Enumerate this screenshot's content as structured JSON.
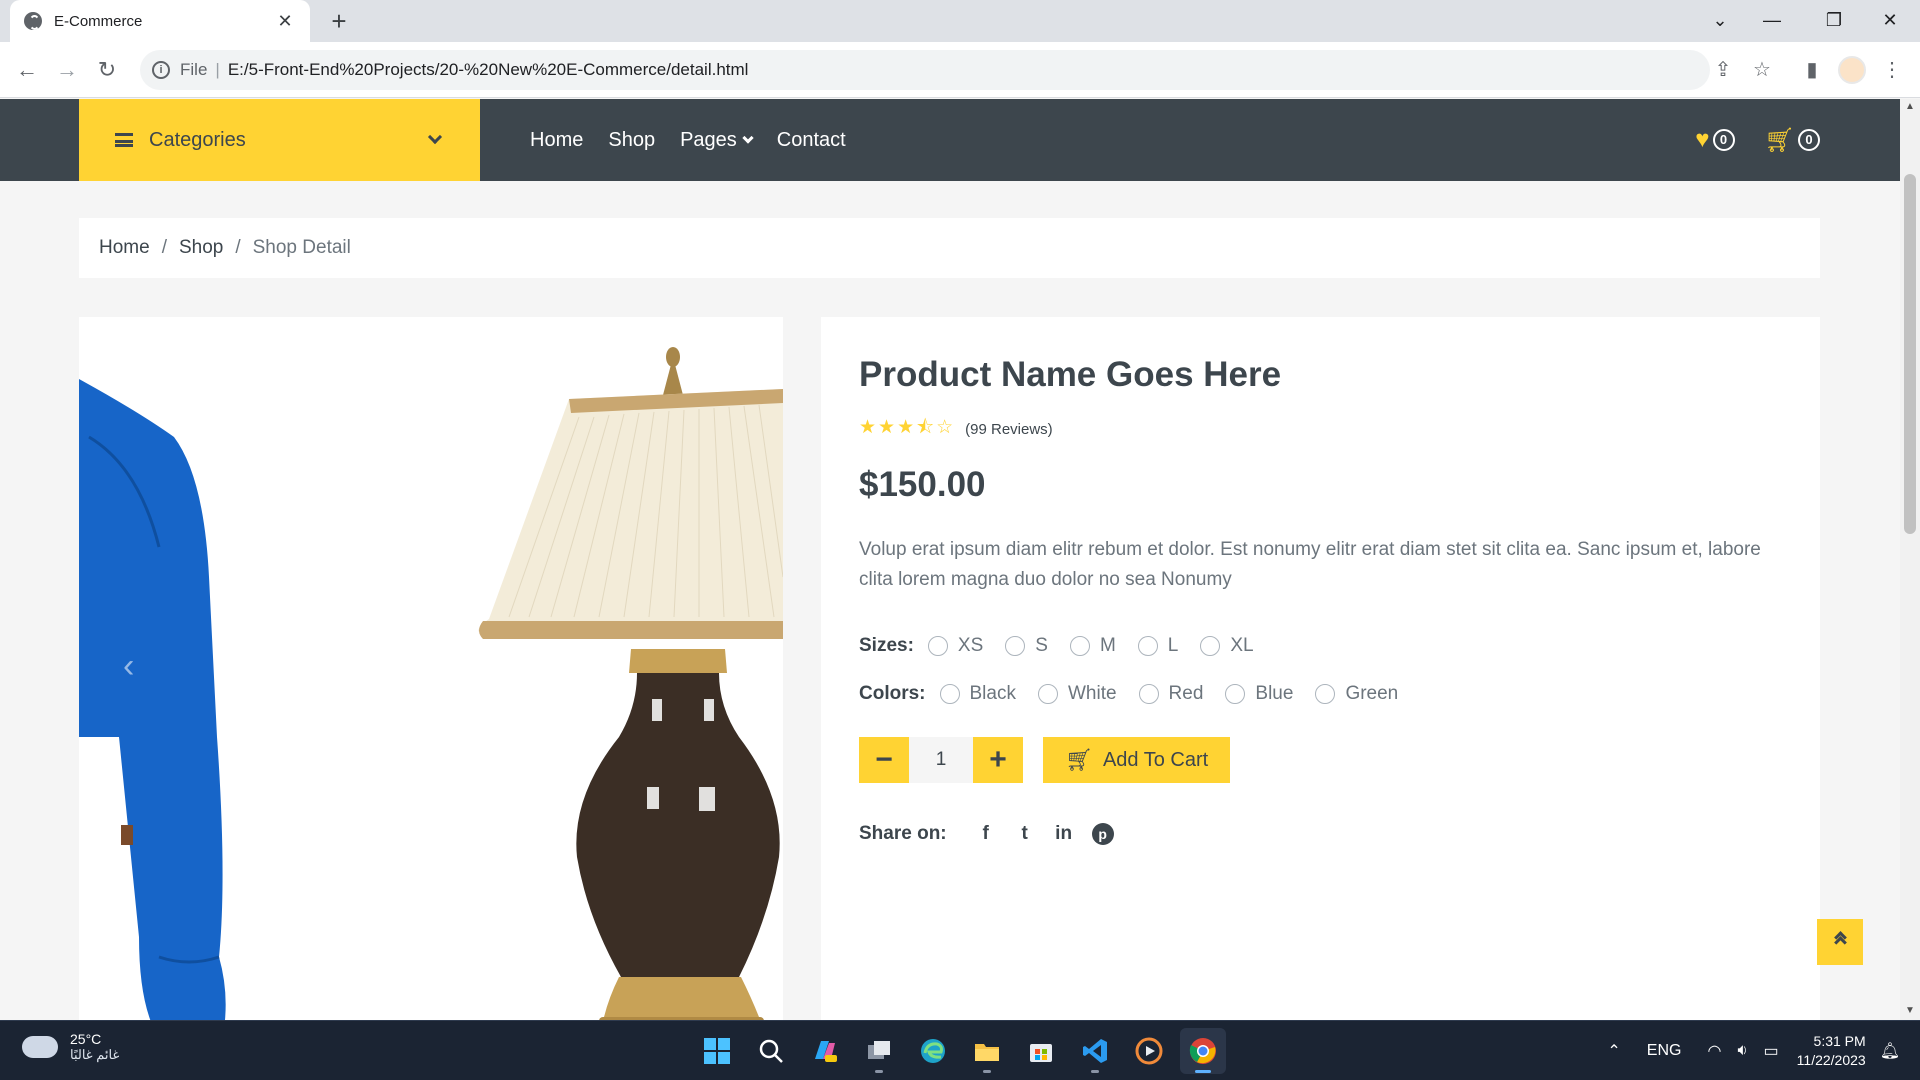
{
  "browser": {
    "tab_title": "E-Commerce",
    "tab_close": "✕",
    "new_tab": "+",
    "scheme": "File",
    "url": "E:/5-Front-End%20Projects/20-%20New%20E-Commerce/detail.html"
  },
  "nav": {
    "categories_label": "Categories",
    "links": [
      "Home",
      "Shop",
      "Pages",
      "Contact"
    ],
    "wishlist_count": "0",
    "cart_count": "0"
  },
  "breadcrumb": {
    "home": "Home",
    "shop": "Shop",
    "current": "Shop Detail",
    "separator": "/"
  },
  "product": {
    "name": "Product Name Goes Here",
    "rating": 3.5,
    "stars": "★★★⯪☆",
    "reviews": "(99 Reviews)",
    "price": "$150.00",
    "description": "Volup erat ipsum diam elitr rebum et dolor. Est nonumy elitr erat diam stet sit clita ea. Sanc ipsum et, labore clita lorem magna duo dolor no sea Nonumy",
    "sizes_label": "Sizes:",
    "sizes": [
      "XS",
      "S",
      "M",
      "L",
      "XL"
    ],
    "colors_label": "Colors:",
    "colors": [
      "Black",
      "White",
      "Red",
      "Blue",
      "Green"
    ],
    "quantity": "1",
    "minus": "−",
    "plus": "+",
    "add_to_cart": "Add To Cart",
    "share_label": "Share on:",
    "share": [
      "f",
      "t",
      "in",
      "p"
    ]
  },
  "taskbar": {
    "temperature": "25°C",
    "condition": "غائم غالبًا",
    "language": "ENG",
    "time": "5:31 PM",
    "date": "11/22/2023"
  },
  "colors": {
    "accent": "#ffd333",
    "dark": "#3d464d",
    "muted": "#6c757d"
  }
}
